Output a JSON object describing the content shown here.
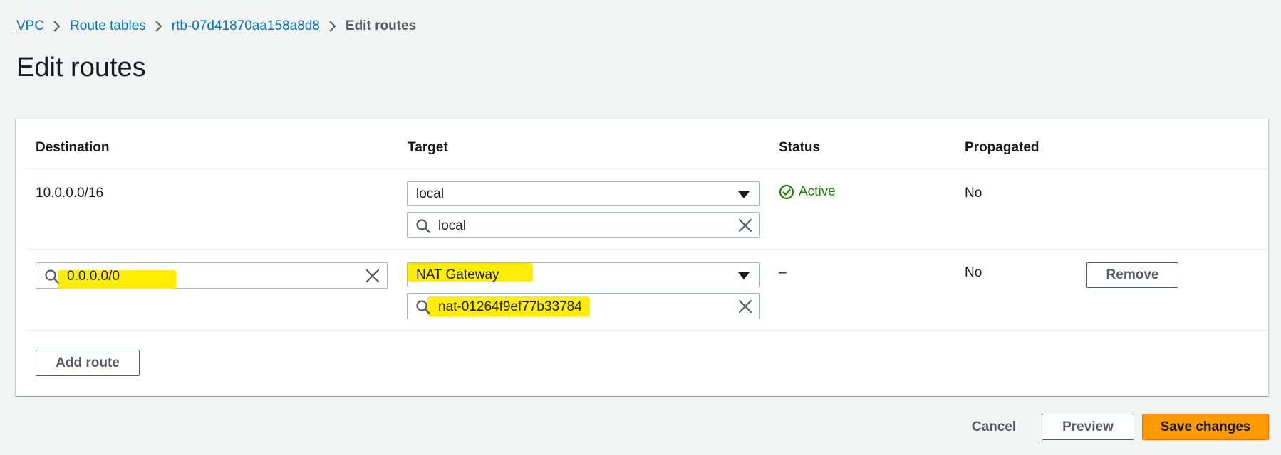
{
  "breadcrumb": {
    "vpc": "VPC",
    "route_tables": "Route tables",
    "route_table_id": "rtb-07d41870aa158a8d8",
    "current": "Edit routes"
  },
  "page_title": "Edit routes",
  "table": {
    "headers": {
      "destination": "Destination",
      "target": "Target",
      "status": "Status",
      "propagated": "Propagated"
    },
    "rows": [
      {
        "destination": "10.0.0.0/16",
        "target_type": "local",
        "target_search": "local",
        "status": "Active",
        "propagated": "No"
      },
      {
        "destination": "0.0.0.0/0",
        "target_type": "NAT Gateway",
        "target_search": "nat-01264f9ef77b33784",
        "status": "–",
        "propagated": "No",
        "remove_label": "Remove"
      }
    ]
  },
  "add_route_label": "Add route",
  "footer": {
    "cancel": "Cancel",
    "preview": "Preview",
    "save": "Save changes"
  },
  "colors": {
    "accent": "#ff9900",
    "link": "#0073bb",
    "active": "#1d8102",
    "highlight": "#ffee00"
  }
}
